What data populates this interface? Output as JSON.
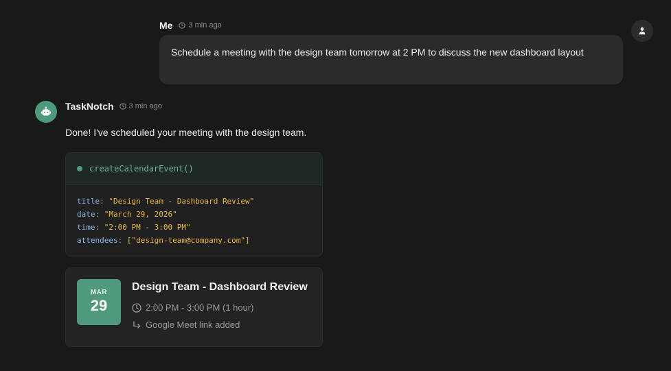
{
  "user_message": {
    "sender": "Me",
    "timestamp": "3 min ago",
    "text": "Schedule a meeting with the design team tomorrow at 2 PM to discuss the new dashboard layout",
    "avatar_icon": "person-icon"
  },
  "bot_message": {
    "sender": "TaskNotch",
    "timestamp": "3 min ago",
    "text": "Done! I've scheduled your meeting with the design team.",
    "avatar_icon": "robot-icon",
    "avatar_color": "#4f9a7c"
  },
  "tool_call": {
    "function": "createCalendarEvent()",
    "status_color": "#4f9a7c",
    "args": [
      {
        "key": "title",
        "value": "\"Design Team - Dashboard Review\""
      },
      {
        "key": "date",
        "value": "\"March 29, 2026\""
      },
      {
        "key": "time",
        "value": "\"2:00 PM - 3:00 PM\""
      },
      {
        "key": "attendees",
        "value": "[\"design-team@company.com\"]"
      }
    ]
  },
  "event": {
    "month": "MAR",
    "day": "29",
    "title": "Design Team - Dashboard Review",
    "time": "2:00 PM - 3:00 PM (1 hour)",
    "note": "Google Meet link added",
    "time_icon": "clock-icon",
    "note_icon": "return-arrow-icon",
    "badge_color": "#4f9a7c"
  },
  "colors": {
    "background": "#191919",
    "accent": "#4f9a7c",
    "code_key": "#8cb6ea",
    "code_value": "#f0b941"
  }
}
